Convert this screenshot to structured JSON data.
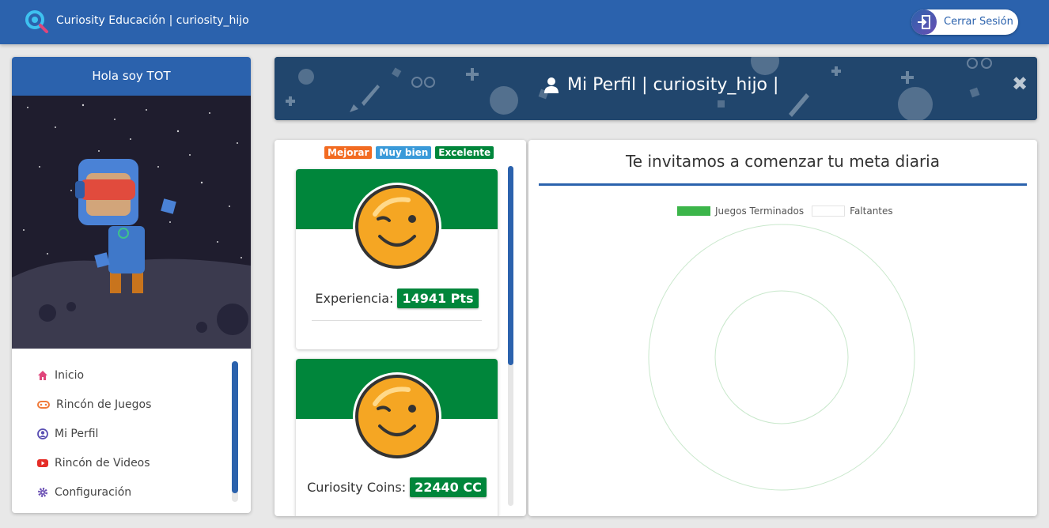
{
  "header": {
    "brand": "Curiosity Educación | curiosity_hijo",
    "logout_label": "Cerrar Sesión"
  },
  "sidebar": {
    "title": "Hola soy TOT",
    "items": [
      {
        "label": "Inicio",
        "icon": "home-icon",
        "color": "#e0457b"
      },
      {
        "label": "Rincón de Juegos",
        "icon": "gamepad-icon",
        "color": "#f07b3a"
      },
      {
        "label": "Mi Perfil",
        "icon": "user-circle-icon",
        "color": "#5a4fb3"
      },
      {
        "label": "Rincón de Videos",
        "icon": "youtube-icon",
        "color": "#e52d27"
      },
      {
        "label": "Configuración",
        "icon": "gear-icon",
        "color": "#6a4fb3"
      }
    ]
  },
  "banner": {
    "title": "Mi Perfil | curiosity_hijo |"
  },
  "stats": {
    "legend": [
      {
        "label": "Mejorar",
        "color": "#f26b21"
      },
      {
        "label": "Muy bien",
        "color": "#3a9ad9"
      },
      {
        "label": "Excelente",
        "color": "#00863b"
      }
    ],
    "cards": [
      {
        "label": "Experiencia:",
        "value": "14941 Pts"
      },
      {
        "label": "Curiosity Coins:",
        "value": "22440 CC"
      }
    ]
  },
  "goal": {
    "title": "Te invitamos a comenzar tu meta diaria"
  },
  "chart_data": {
    "type": "pie",
    "title": "",
    "legend_position": "top",
    "series": [
      {
        "name": "Juegos Terminados",
        "color": "#3cb54a"
      },
      {
        "name": "Faltantes",
        "color": "#ffffff"
      }
    ],
    "categories": [
      "Juegos Terminados",
      "Faltantes"
    ],
    "values": [
      0,
      1
    ]
  },
  "colors": {
    "primary": "#2b62ad",
    "success": "#00863b",
    "banner": "#21466d"
  }
}
